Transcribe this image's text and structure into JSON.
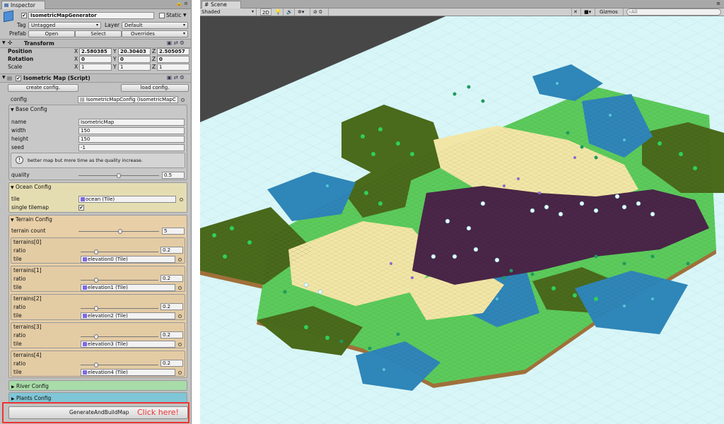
{
  "inspector": {
    "tab_title": "Inspector",
    "object_name": "IsometricMapGenerator",
    "static_label": "Static",
    "tag_label": "Tag",
    "tag_value": "Untagged",
    "layer_label": "Layer",
    "layer_value": "Default",
    "prefab_label": "Prefab",
    "prefab_buttons": [
      "Open",
      "Select",
      "Overrides"
    ]
  },
  "transform": {
    "title": "Transform",
    "position_label": "Position",
    "rotation_label": "Rotation",
    "scale_label": "Scale",
    "position": [
      "2.580385",
      "20.30403",
      "2.505057"
    ],
    "rotation": [
      "0",
      "0",
      "0"
    ],
    "scale": [
      "1",
      "1",
      "1"
    ],
    "axes": [
      "X",
      "Y",
      "Z"
    ]
  },
  "script": {
    "title": "Isometric Map (Script)",
    "create_button": "create config.",
    "load_button": "load config.",
    "config_label": "config",
    "config_value": "IsometricMapConfig (IsometricMapC"
  },
  "base_config": {
    "title": "Base Config",
    "name_label": "name",
    "name_value": "IsometricMap",
    "width_label": "width",
    "width_value": "150",
    "height_label": "height",
    "height_value": "150",
    "seed_label": "seed",
    "seed_value": "-1",
    "info_text": "better map but more time as the quality increase.",
    "quality_label": "quality",
    "quality_value": "0.5",
    "quality_fraction": 0.5
  },
  "ocean_config": {
    "title": "Ocean Config",
    "tile_label": "tile",
    "tile_value": "ocean (Tile)",
    "single_label": "single tilemap"
  },
  "terrain_config": {
    "title": "Terrain Config",
    "count_label": "terrain count",
    "count_value": "5",
    "count_fraction": 0.52,
    "ratio_label": "ratio",
    "tile_label": "tile",
    "terrains": [
      {
        "header": "terrains[0]",
        "ratio": "0.2",
        "tile": "elevation0 (Tile)"
      },
      {
        "header": "terrains[1]",
        "ratio": "0.2",
        "tile": "elevation1 (Tile)"
      },
      {
        "header": "terrains[2]",
        "ratio": "0.2",
        "tile": "elevation2 (Tile)"
      },
      {
        "header": "terrains[3]",
        "ratio": "0.2",
        "tile": "elevation3 (Tile)"
      },
      {
        "header": "terrains[4]",
        "ratio": "0.2",
        "tile": "elevation4 (Tile)"
      }
    ]
  },
  "river_config": {
    "title": "River Config"
  },
  "plants_config": {
    "title": "Plants Config"
  },
  "generate_button": "GenerateAndBuildMap",
  "click_here": "Click here!",
  "scene": {
    "tab_title": "Scene",
    "shading": "Shaded",
    "mode_2d": "2D",
    "fx_count": "0",
    "gizmos": "Gizmos",
    "search_placeholder": "All"
  },
  "colors": {
    "ocean": "#d8f6f7",
    "ice": "#56b0cc",
    "water": "#2f86b8",
    "grass": "#5ccb5c",
    "forest": "#4a6a1c",
    "sand": "#f2e6a6",
    "mountain": "#4a2648",
    "dirt": "#a0703a",
    "highlight": "#e33333"
  }
}
